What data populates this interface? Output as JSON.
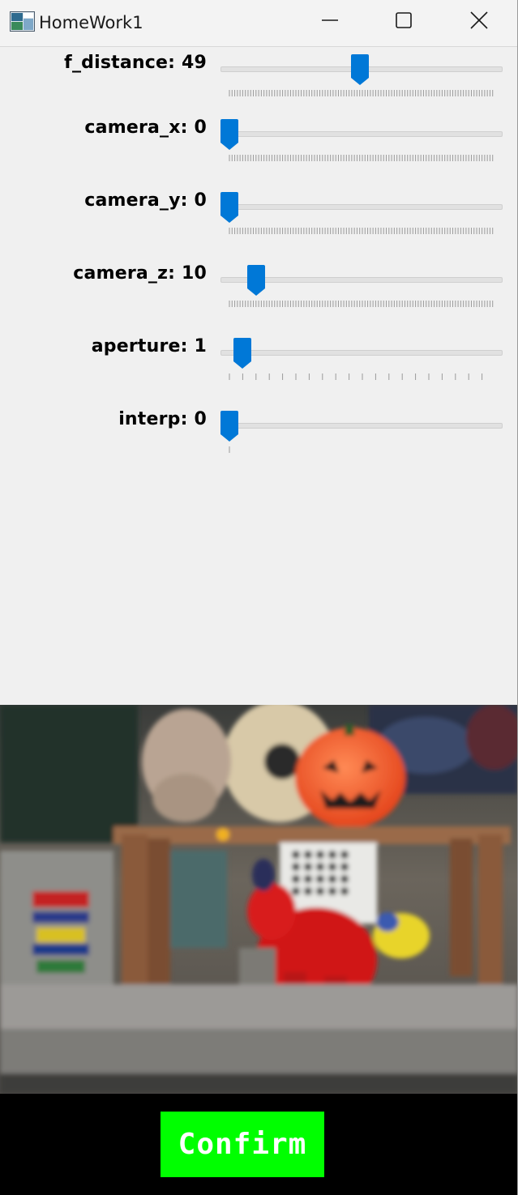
{
  "window": {
    "title": "HomeWork1"
  },
  "trackbars": [
    {
      "label": "f_distance: 49",
      "value": 49,
      "max": 100,
      "tick_style": "dense"
    },
    {
      "label": "camera_x: 0",
      "value": 0,
      "max": 100,
      "tick_style": "dense"
    },
    {
      "label": "camera_y: 0",
      "value": 0,
      "max": 100,
      "tick_style": "dense"
    },
    {
      "label": "camera_z: 10",
      "value": 10,
      "max": 100,
      "tick_style": "dense"
    },
    {
      "label": "aperture: 1",
      "value": 1,
      "max": 20,
      "tick_style": "sparse"
    },
    {
      "label": "interp: 0",
      "value": 0,
      "max": 1,
      "tick_style": "ends"
    }
  ],
  "button": {
    "confirm_label": "Confirm"
  },
  "colors": {
    "thumb": "#0078d7",
    "confirm_bg": "#00ff00",
    "panel_bg": "#f0f0f0"
  },
  "icons": {
    "app": "app-window-icon",
    "minimize": "minimize-icon",
    "maximize": "maximize-icon",
    "close": "close-icon"
  }
}
